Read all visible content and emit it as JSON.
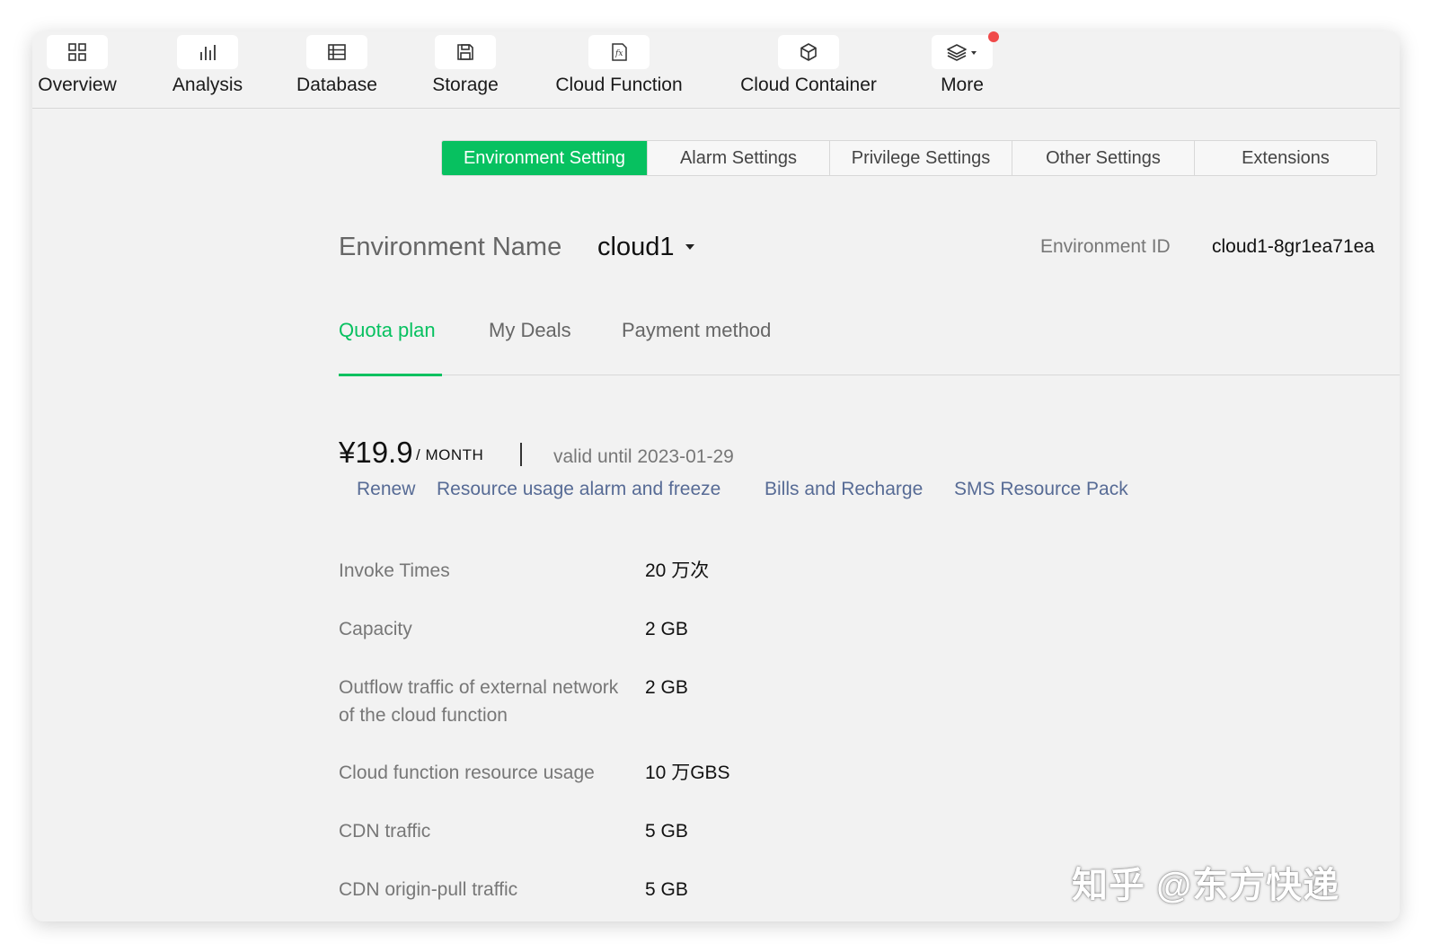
{
  "toolbar": {
    "items": [
      {
        "label": "Overview",
        "icon": "grid-icon"
      },
      {
        "label": "Analysis",
        "icon": "bar-chart-icon"
      },
      {
        "label": "Database",
        "icon": "database-icon"
      },
      {
        "label": "Storage",
        "icon": "floppy-icon"
      },
      {
        "label": "Cloud Function",
        "icon": "function-icon"
      },
      {
        "label": "Cloud Container",
        "icon": "cube-icon"
      },
      {
        "label": "More",
        "icon": "layers-icon"
      }
    ]
  },
  "settings_tabs": [
    "Environment Setting",
    "Alarm Settings",
    "Privilege Settings",
    "Other Settings",
    "Extensions"
  ],
  "environment": {
    "name_label": "Environment Name",
    "name_value": "cloud1",
    "id_label": "Environment ID",
    "id_value": "cloud1-8gr1ea71ea"
  },
  "subtabs": [
    "Quota plan",
    "My Deals",
    "Payment method"
  ],
  "plan": {
    "price": "¥19.9",
    "per": "/ MONTH",
    "valid": "valid until 2023-01-29",
    "links": [
      "Renew",
      "Resource usage alarm and freeze",
      "Bills and Recharge",
      "SMS Resource Pack"
    ]
  },
  "quota": [
    {
      "label": "Invoke Times",
      "value": "20 万次"
    },
    {
      "label": "Capacity",
      "value": "2 GB"
    },
    {
      "label": "Outflow traffic of external network of the cloud function",
      "value": "2 GB"
    },
    {
      "label": "Cloud function resource usage",
      "value": "10 万GBS"
    },
    {
      "label": "CDN traffic",
      "value": "5 GB"
    },
    {
      "label": "CDN origin-pull traffic",
      "value": "5 GB"
    }
  ],
  "watermark": "知乎 @东方快递",
  "colors": {
    "accent": "#07c160",
    "link": "#576b95",
    "badge": "#f04a4a"
  }
}
